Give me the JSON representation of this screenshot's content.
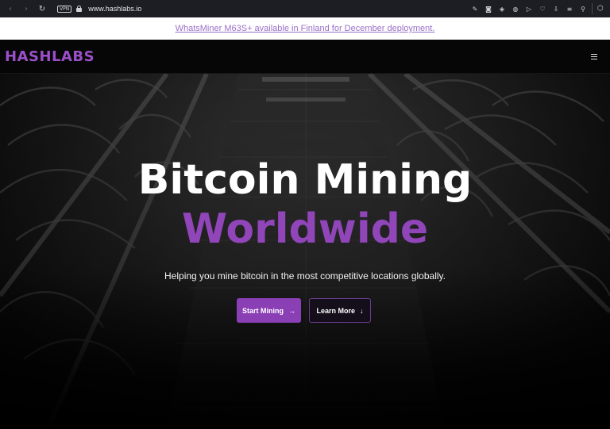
{
  "browser": {
    "url": "www.hashlabs.io",
    "vpn_label": "VPN"
  },
  "announcement": {
    "text": "WhatsMiner M63S+ available in Finland for December deployment."
  },
  "nav": {
    "logo": "HASHLABS"
  },
  "hero": {
    "title_line1": "Bitcoin Mining",
    "title_line2": "Worldwide",
    "subtitle": "Helping you mine bitcoin in the most competitive locations globally.",
    "primary_button": "Start Mining",
    "secondary_button": "Learn More"
  },
  "colors": {
    "brand": "#9b4fc8",
    "accent_text": "#9045b8",
    "button_primary": "#8a3fb5",
    "announcement_link": "#9b6fc9"
  },
  "icons": {
    "back": "arrow-left-icon",
    "forward": "arrow-right-icon",
    "reload": "reload-icon",
    "lock": "lock-icon",
    "menu": "hamburger-menu-icon",
    "start_arrow": "arrow-right-icon",
    "learn_arrow": "arrow-down-icon"
  }
}
